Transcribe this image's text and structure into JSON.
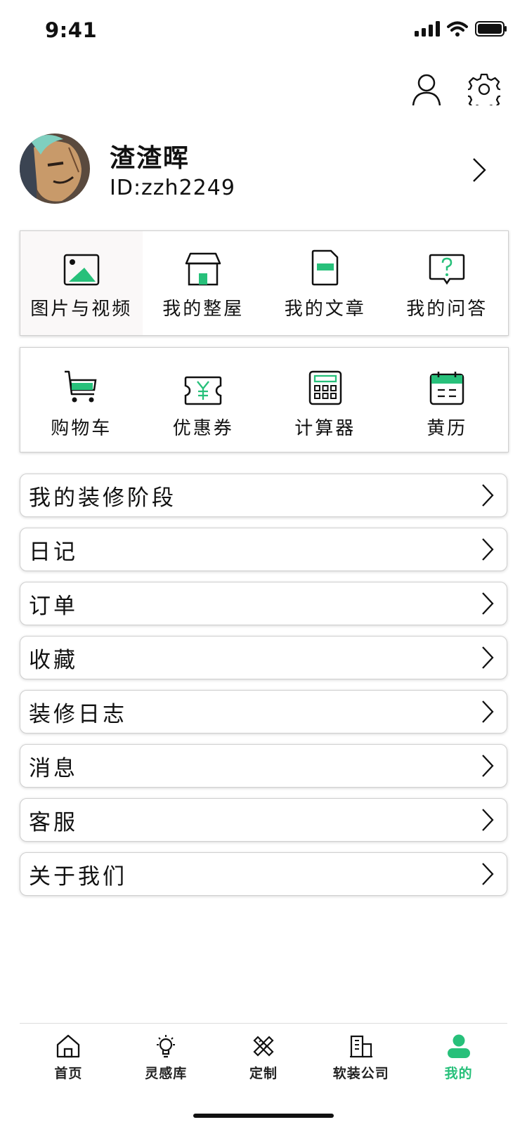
{
  "status_bar": {
    "time": "9:41"
  },
  "profile": {
    "name": "渣渣晖",
    "id": "ID:zzh2249"
  },
  "grid1": [
    {
      "label": "图片与视频",
      "icon": "image-icon"
    },
    {
      "label": "我的整屋",
      "icon": "house-icon"
    },
    {
      "label": "我的文章",
      "icon": "article-icon"
    },
    {
      "label": "我的问答",
      "icon": "question-icon"
    }
  ],
  "grid2": [
    {
      "label": "购物车",
      "icon": "cart-icon"
    },
    {
      "label": "优惠券",
      "icon": "coupon-icon"
    },
    {
      "label": "计算器",
      "icon": "calculator-icon"
    },
    {
      "label": "黄历",
      "icon": "calendar-icon"
    }
  ],
  "menu": [
    "我的装修阶段",
    "日记",
    "订单",
    "收藏",
    "装修日志",
    "消息",
    "客服",
    "关于我们"
  ],
  "tabs": [
    {
      "label": "首页",
      "icon": "home-icon"
    },
    {
      "label": "灵感库",
      "icon": "lightbulb-icon"
    },
    {
      "label": "定制",
      "icon": "tools-icon"
    },
    {
      "label": "软装公司",
      "icon": "building-icon"
    },
    {
      "label": "我的",
      "icon": "person-icon",
      "active": true
    }
  ],
  "colors": {
    "accent": "#27c07a",
    "border": "#cfcfcf"
  }
}
